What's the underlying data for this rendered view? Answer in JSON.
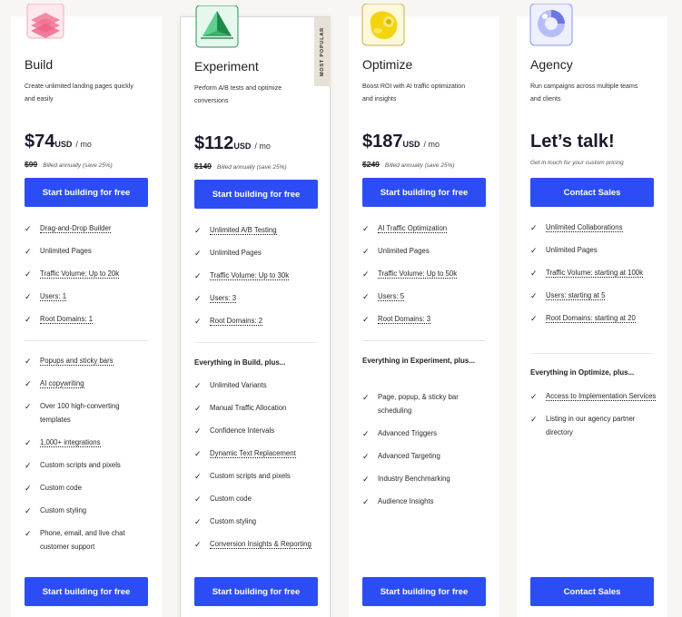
{
  "plans": [
    {
      "name": "Build",
      "desc": "Create unlimited landing pages quickly and easily",
      "price": "$74",
      "currency": "USD",
      "period": "/ mo",
      "old_price": "$99",
      "billing_note": "Billed annually (save 25%)",
      "cta_top": "Start building for free",
      "cta_bottom": "Start building for free",
      "features": [
        "Drag-and-Drop Builder",
        "Unlimited Pages",
        "Traffic Volume: Up to 20k",
        "Users: 1",
        "Root Domains: 1"
      ],
      "extras": [
        "Popups and sticky bars",
        "AI copywriting",
        "Over 100 high-converting templates",
        "1,000+ integrations",
        "Custom scripts and pixels",
        "Custom code",
        "Custom styling",
        "Phone, email, and live chat customer support"
      ]
    },
    {
      "name": "Experiment",
      "badge": "Most Popular",
      "desc": "Perform A/B tests and optimize conversions",
      "price": "$112",
      "currency": "USD",
      "period": "/ mo",
      "old_price": "$149",
      "billing_note": "Billed annually (save 25%)",
      "cta_top": "Start building for free",
      "cta_bottom": "Start building for free",
      "features": [
        "Unlimited A/B Testing",
        "Unlimited Pages",
        "Traffic Volume: Up to 30k",
        "Users: 3",
        "Root Domains: 2"
      ],
      "section_head": "Everything in Build, plus...",
      "extras": [
        "Unlimited Variants",
        "Manual Traffic Allocation",
        "Confidence Intervals",
        "Dynamic Text Replacement",
        "Custom scripts and pixels",
        "Custom code",
        "Custom styling",
        "Conversion Insights & Reporting"
      ]
    },
    {
      "name": "Optimize",
      "desc": "Boost ROI with AI traffic optimization and insights",
      "price": "$187",
      "currency": "USD",
      "period": "/ mo",
      "old_price": "$249",
      "billing_note": "Billed annually (save 25%)",
      "cta_top": "Start building for free",
      "cta_bottom": "Start building for free",
      "features": [
        "AI Traffic Optimization",
        "Unlimited Pages",
        "Traffic Volume: Up to 50k",
        "Users: 5",
        "Root Domains: 3"
      ],
      "section_head": "Everything in Experiment, plus...",
      "extras": [
        "Page, popup, & sticky bar scheduling",
        "Advanced Triggers",
        "Advanced Targeting",
        "Industry Benchmarking",
        "Audience Insights"
      ]
    },
    {
      "name": "Agency",
      "desc": "Run campaigns across multiple teams and clients",
      "price_text": "Let’s talk!",
      "talk_note": "Get in touch for your custom pricing",
      "cta_top": "Contact Sales",
      "cta_bottom": "Contact Sales",
      "features": [
        "Unlimited Collaborations",
        "Unlimited Pages",
        "Traffic Volume: starting at 100k",
        "Users: starting at 5",
        "Root Domains: starting at 20"
      ],
      "section_head": "Everything in Optimize, plus...",
      "extras": [
        "Access to Implementation Services",
        "Listing in our agency partner directory"
      ]
    }
  ],
  "check_glyph": "✓",
  "colors": {
    "cta": "#2c4df5",
    "page_bg": "#f7f6f3",
    "badge_bg": "#e8e1d8"
  }
}
